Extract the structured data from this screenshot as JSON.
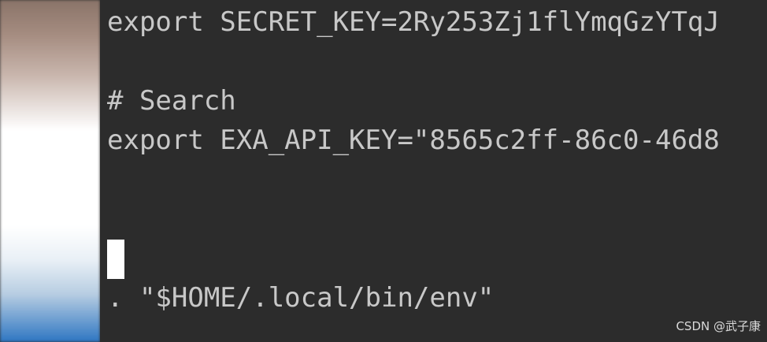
{
  "terminal": {
    "lines": [
      "export SECRET_KEY=2Ry253Zj1flYmqGzYTqJ",
      "# Search",
      "export EXA_API_KEY=\"8565c2ff-86c0-46d8",
      ". \"$HOME/.local/bin/env\""
    ]
  },
  "watermark": "CSDN @武子康",
  "colors": {
    "terminal_bg": "#2c2c2c",
    "text": "#c8c8c8",
    "cursor": "#ffffff"
  }
}
